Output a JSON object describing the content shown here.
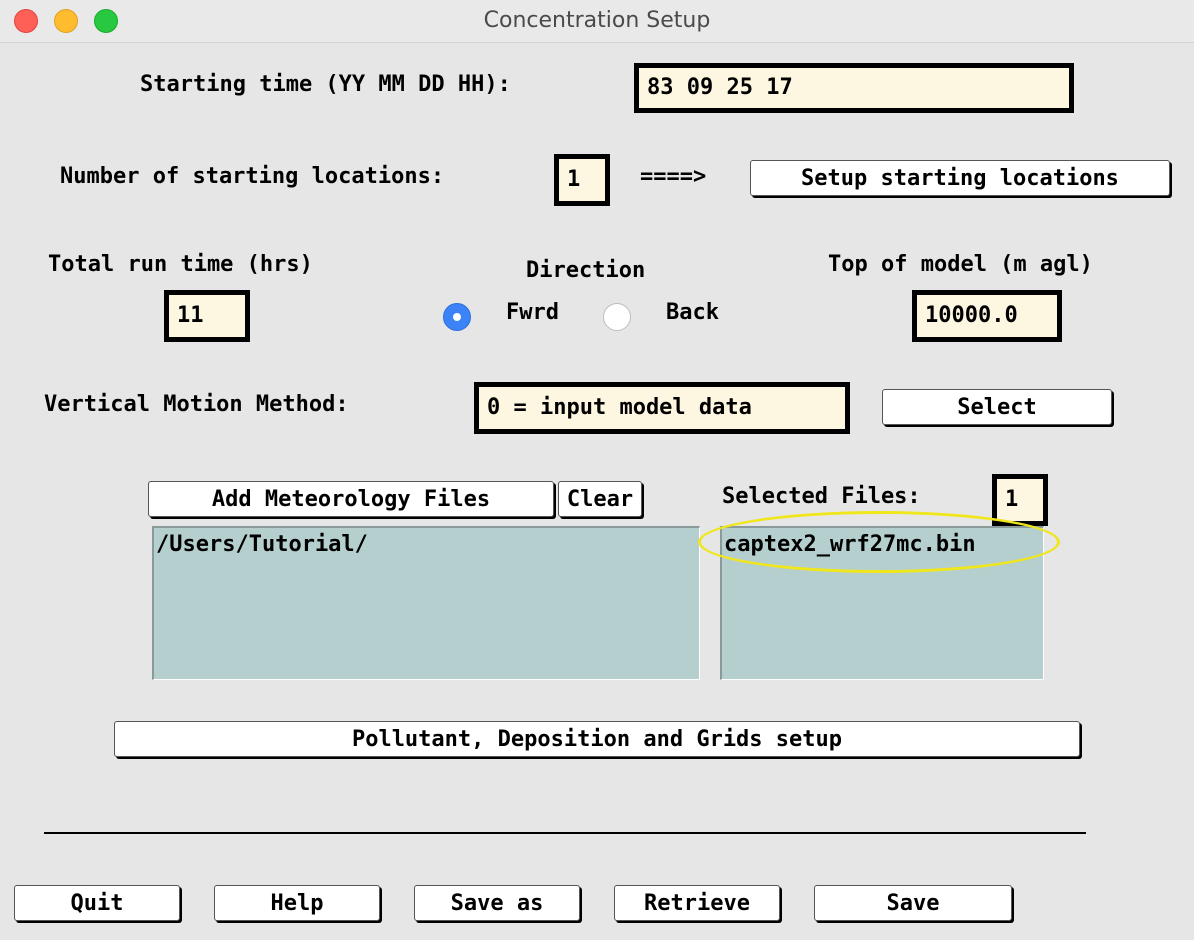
{
  "window": {
    "title": "Concentration Setup"
  },
  "start_time": {
    "label": "Starting time (YY MM DD HH):",
    "value": "83 09 25 17"
  },
  "locations": {
    "label": "Number of starting locations:",
    "count": "1",
    "arrow": "====>",
    "setup_button": "Setup starting locations"
  },
  "run_time": {
    "label": "Total run time (hrs)",
    "value": "11"
  },
  "direction": {
    "label": "Direction",
    "forward_label": "Fwrd",
    "back_label": "Back",
    "selected": "Fwrd"
  },
  "top_model": {
    "label": "Top of model (m agl)",
    "value": "10000.0"
  },
  "vertical_motion": {
    "label": "Vertical Motion Method:",
    "value": "0 = input model data",
    "select_button": "Select"
  },
  "meteorology": {
    "add_button": "Add Meteorology Files",
    "clear_button": "Clear",
    "directory_path": "/Users/Tutorial/",
    "selected_label": "Selected Files:",
    "selected_count": "1",
    "selected_files": [
      "captex2_wrf27mc.bin"
    ]
  },
  "pollutant_button": "Pollutant, Deposition and Grids setup",
  "bottom_buttons": {
    "quit": "Quit",
    "help": "Help",
    "save_as": "Save as",
    "retrieve": "Retrieve",
    "save": "Save"
  },
  "colors": {
    "entry_background": "#fdf6e0",
    "listbox_background": "#b5cfcf",
    "radio_selected": "#3b83f6",
    "highlight_ellipse": "#f0e61c"
  }
}
